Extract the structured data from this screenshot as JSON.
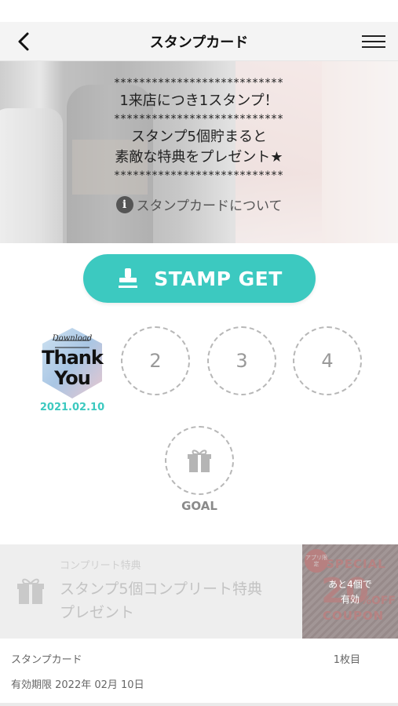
{
  "header": {
    "title": "スタンプカード",
    "back_icon": "chevron-left-icon",
    "menu_icon": "hamburger-menu-icon"
  },
  "hero": {
    "stars": "***************************",
    "line1": "1来店につき1スタンプ！",
    "line2a": "スタンプ5個貯まると",
    "line2b": "素敵な特典をプレゼント★",
    "info_glyph": "i",
    "about_link": "スタンプカードについて"
  },
  "stamp_button": {
    "label": "STAMP GET",
    "icon": "stamp-icon",
    "color": "#3cc9c0"
  },
  "stamps": {
    "first": {
      "image_text_top": "Download",
      "image_text_main1": "Thank",
      "image_text_main2": "You",
      "date": "2021.02.10"
    },
    "slots": [
      "2",
      "3",
      "4"
    ],
    "goal_label": "GOAL"
  },
  "complete_reward": {
    "small_label": "コンプリート特典",
    "title_line1": "スタンプ5個コンプリート特典",
    "title_line2": "プレゼント",
    "coupon": {
      "badge": "アプリ限定",
      "special": "SPECIAL",
      "number": "20",
      "off": "%OFF",
      "coupon_word": "COUPON",
      "note_line1": "あと4個で",
      "note_line2": "有効"
    }
  },
  "footer": {
    "card_label": "スタンプカード",
    "card_count": "1枚目",
    "expiry": "有効期限 2022年 02月 10日"
  }
}
